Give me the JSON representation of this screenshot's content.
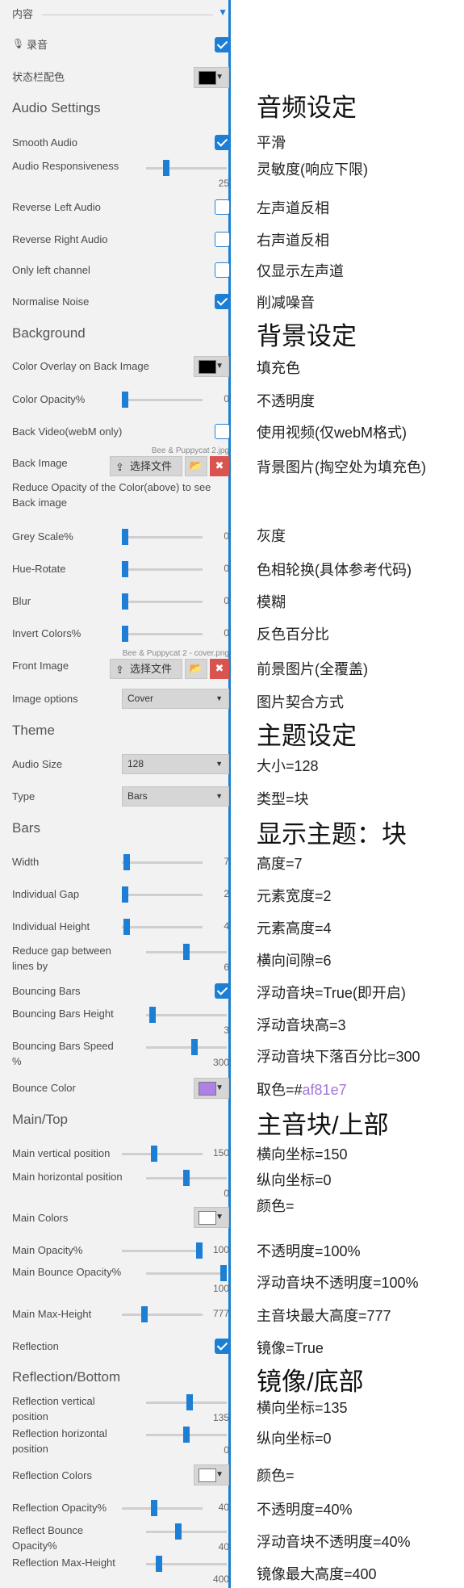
{
  "panel": {
    "top": {
      "label": "内容"
    },
    "record": {
      "label": "录音",
      "checked": true
    },
    "statusbar": {
      "label": "状态栏配色",
      "color": "#000000"
    },
    "audio": {
      "title": "Audio Settings",
      "smooth": {
        "label": "Smooth Audio",
        "checked": true
      },
      "responsiveness": {
        "label": "Audio Responsiveness",
        "value": "25",
        "fraction": 0.25
      },
      "reverse_left": {
        "label": "Reverse Left Audio",
        "checked": false
      },
      "reverse_right": {
        "label": "Reverse Right Audio",
        "checked": false
      },
      "only_left": {
        "label": "Only left channel",
        "checked": false
      },
      "normalise": {
        "label": "Normalise Noise",
        "checked": true
      }
    },
    "background": {
      "title": "Background",
      "overlay": {
        "label": "Color Overlay on Back Image",
        "color": "#000000"
      },
      "opacity": {
        "label": "Color Opacity%",
        "value": "0",
        "fraction": 0.0
      },
      "video": {
        "label": "Back Video(webM only)",
        "checked": false
      },
      "back_image": {
        "label": "Back Image",
        "file_name": "Bee & Puppycat 2.jpg",
        "choose_label": "选择文件"
      },
      "reduce_opacity": {
        "label": "Reduce Opacity of the Color(above) to see Back image"
      },
      "grey": {
        "label": "Grey Scale%",
        "value": "0",
        "fraction": 0.0
      },
      "hue": {
        "label": "Hue-Rotate",
        "value": "0",
        "fraction": 0.0
      },
      "blur": {
        "label": "Blur",
        "value": "0",
        "fraction": 0.0
      },
      "invert": {
        "label": "Invert Colors%",
        "value": "0",
        "fraction": 0.0
      },
      "front_image": {
        "label": "Front Image",
        "file_name": "Bee & Puppycat 2 - cover.png",
        "choose_label": "选择文件"
      },
      "image_options": {
        "label": "Image options",
        "selected": "Cover"
      }
    },
    "theme": {
      "title": "Theme",
      "audio_size": {
        "label": "Audio Size",
        "selected": "128"
      },
      "type": {
        "label": "Type",
        "selected": "Bars"
      }
    },
    "bars": {
      "title": "Bars",
      "width": {
        "label": "Width",
        "value": "7",
        "fraction": 0.06
      },
      "gap": {
        "label": "Individual Gap",
        "value": "2",
        "fraction": 0.02
      },
      "height": {
        "label": "Individual Height",
        "value": "4",
        "fraction": 0.06
      },
      "reduce_gap": {
        "label": "Reduce gap between lines by",
        "value": "6",
        "fraction": 0.5
      },
      "bouncing": {
        "label": "Bouncing Bars",
        "checked": true
      },
      "bouncing_height": {
        "label": "Bouncing Bars Height",
        "value": "3",
        "fraction": 0.08
      },
      "bouncing_speed": {
        "label": "Bouncing Bars Speed %",
        "value": "300",
        "fraction": 0.6
      },
      "bounce_color": {
        "label": "Bounce Color",
        "color": "#af81e7"
      }
    },
    "main": {
      "title": "Main/Top",
      "vertical": {
        "label": "Main vertical position",
        "value": "150",
        "fraction": 0.4
      },
      "horizontal": {
        "label": "Main horizontal position",
        "value": "0",
        "fraction": 0.5
      },
      "colors": {
        "label": "Main Colors",
        "color": "#ffffff"
      },
      "opacity": {
        "label": "Main Opacity%",
        "value": "100",
        "fraction": 1.0
      },
      "bounce_opacity": {
        "label": "Main Bounce Opacity%",
        "value": "100",
        "fraction": 1.0
      },
      "max_height": {
        "label": "Main Max-Height",
        "value": "777",
        "fraction": 0.28
      },
      "reflection": {
        "label": "Reflection",
        "checked": true
      }
    },
    "reflection": {
      "title": "Reflection/Bottom",
      "vertical": {
        "label": "Reflection vertical position",
        "value": "135",
        "fraction": 0.54
      },
      "horizontal": {
        "label": "Reflection horizontal position",
        "value": "0",
        "fraction": 0.5
      },
      "colors": {
        "label": "Reflection Colors",
        "color": "#ffffff"
      },
      "opacity": {
        "label": "Reflection Opacity%",
        "value": "40",
        "fraction": 0.4
      },
      "bounce_opacity": {
        "label": "Reflect Bounce Opacity%",
        "value": "40",
        "fraction": 0.4
      },
      "max_height": {
        "label": "Reflection Max-Height",
        "value": "400",
        "fraction": 0.16
      }
    }
  },
  "notes": {
    "audio_title": "音频设定",
    "smooth": "平滑",
    "responsiveness": "灵敏度(响应下限)",
    "reverse_left": "左声道反相",
    "reverse_right": "右声道反相",
    "only_left": "仅显示左声道",
    "normalise": "削减噪音",
    "bg_title": "背景设定",
    "overlay": "填充色",
    "opacity": "不透明度",
    "video": "使用视频(仅webM格式)",
    "back_image": "背景图片(掏空处为填充色)",
    "grey": "灰度",
    "hue": "色相轮换(具体参考代码)",
    "blur": "模糊",
    "invert": "反色百分比",
    "front_image": "前景图片(全覆盖)",
    "image_options": "图片契合方式",
    "theme_title": "主题设定",
    "audio_size": "大小=128",
    "type": "类型=块",
    "bars_title": "显示主题：块",
    "width": "高度=7",
    "gap": "元素宽度=2",
    "height": "元素高度=4",
    "reduce_gap": "横向间隙=6",
    "bouncing": "浮动音块=True(即开启)",
    "bouncing_height": "浮动音块高=3",
    "bouncing_speed": "浮动音块下落百分比=300",
    "bounce_color_prefix": "取色=#",
    "bounce_color_hex": "af81e7",
    "main_title": "主音块/上部",
    "main_vertical": "横向坐标=150",
    "main_horizontal": "纵向坐标=0",
    "main_colors": "颜色=",
    "main_opacity": "不透明度=100%",
    "main_bounce_opacity": "浮动音块不透明度=100%",
    "main_max_height": "主音块最大高度=777",
    "reflection": "镜像=True",
    "refl_title": "镜像/底部",
    "refl_vertical": "横向坐标=135",
    "refl_horizontal": "纵向坐标=0",
    "refl_colors": "颜色=",
    "refl_opacity": "不透明度=40%",
    "refl_bounce_opacity": "浮动音块不透明度=40%",
    "refl_max_height": "镜像最大高度=400"
  }
}
